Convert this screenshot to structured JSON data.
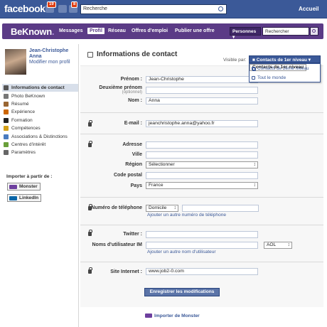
{
  "facebook": {
    "logo": "facebook",
    "friend_requests_count": "19",
    "notifications_count": "8",
    "search_placeholder": "Recherche",
    "home_link": "Accueil"
  },
  "beknown": {
    "logo_text": "BeKnown",
    "logo_dot": ".",
    "nav": [
      "Messages",
      "Profil",
      "Réseau",
      "Offres d'emploi",
      "Publier une offre"
    ],
    "search_scope": "Personnes",
    "search_placeholder": "Rechercher"
  },
  "profile": {
    "name": "Jean-Christophe Anna",
    "edit_link": "Modifier mon profil"
  },
  "sidebar": {
    "items": [
      {
        "label": "Informations de contact",
        "icon": "contact-card-icon",
        "color": "#555555"
      },
      {
        "label": "Photo BeKnown",
        "icon": "photo-icon",
        "color": "#777777"
      },
      {
        "label": "Résumé",
        "icon": "summary-icon",
        "color": "#996633"
      },
      {
        "label": "Expérience",
        "icon": "briefcase-icon",
        "color": "#cc6600"
      },
      {
        "label": "Formation",
        "icon": "graduation-cap-icon",
        "color": "#222222"
      },
      {
        "label": "Compétences",
        "icon": "skills-icon",
        "color": "#d4a017"
      },
      {
        "label": "Associations & Distinctions",
        "icon": "associations-icon",
        "color": "#4a7bbf"
      },
      {
        "label": "Centres d'intérêt",
        "icon": "interests-icon",
        "color": "#6a9f3a"
      },
      {
        "label": "Paramètres",
        "icon": "gear-icon",
        "color": "#666666"
      }
    ],
    "import_label": "Importer à partir de :",
    "import_monster": "Monster",
    "import_linkedin": "LinkedIn"
  },
  "main": {
    "title": "Informations de contact",
    "visible_label": "Visible par:",
    "visibility_selected": "Contacts de 1er niveau",
    "visibility_options": [
      "Contacts de 1er niveau",
      "Contacts de 2ème niveau",
      "Tout le monde"
    ],
    "fields": {
      "prenom_label": "Prénom :",
      "prenom_value": "Jean-Christophe",
      "deuxieme_label": "Deuxième prénom",
      "optionnel": "(optionnel)",
      "deuxieme_value": "",
      "nom_label": "Nom :",
      "nom_value": "Anna",
      "email_label": "E-mail :",
      "email_value": "jeanchristophe.anna@yahoo.fr",
      "adresse_label": "Adresse",
      "ville_label": "Ville",
      "region_label": "Région",
      "region_value": "Sélectionner",
      "code_postal_label": "Code postal",
      "pays_label": "Pays",
      "pays_value": "France",
      "phone_label": "Numéro de téléphone",
      "phone_type": "Domicile",
      "phone_add": "Ajouter un autre numéro de téléphone",
      "twitter_label": "Twitter :",
      "im_label": "Noms d'utilisateur IM",
      "im_service": "AOL",
      "im_add": "Ajouter un autre nom d'utilisateur",
      "website_label": "Site Internet :",
      "website_value": "www.job2-0.com"
    },
    "save_button": "Enregistrer les modifications",
    "import_from_monster": "Importer de Monster"
  }
}
